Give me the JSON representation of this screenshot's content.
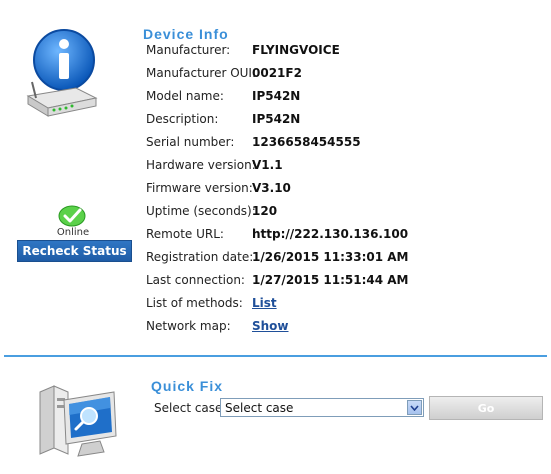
{
  "device_info": {
    "title": "Device  Info",
    "rows": [
      {
        "label": "Manufacturer:",
        "value": "FLYINGVOICE"
      },
      {
        "label": "Manufacturer OUI:",
        "value": "0021F2"
      },
      {
        "label": "Model name:",
        "value": "IP542N"
      },
      {
        "label": "Description:",
        "value": "IP542N"
      },
      {
        "label": "Serial number:",
        "value": "1236658454555"
      },
      {
        "label": "Hardware version:",
        "value": "V1.1"
      },
      {
        "label": "Firmware version:",
        "value": "V3.10"
      },
      {
        "label": "Uptime (seconds):",
        "value": "120"
      },
      {
        "label": "Remote URL:",
        "value": "http://222.130.136.100"
      },
      {
        "label": "Registration date:",
        "value": "1/26/2015 11:33:01 AM"
      },
      {
        "label": "Last connection:",
        "value": "1/27/2015 11:51:44 AM"
      },
      {
        "label": "List of methods:",
        "value": "List"
      },
      {
        "label": "Network map:",
        "value": "Show"
      }
    ]
  },
  "status": {
    "text": "Online",
    "recheck_label": "Recheck Status",
    "icon": "green-check-icon"
  },
  "quick_fix": {
    "title": "Quick  Fix",
    "select_label": "Select case",
    "select_value": "Select case",
    "go_label": "Go"
  },
  "colors": {
    "title_blue": "#3a8fd8",
    "button_blue": "#1f5ca6",
    "divider_blue": "#4a9ee0",
    "link_blue": "#1f4f99"
  }
}
